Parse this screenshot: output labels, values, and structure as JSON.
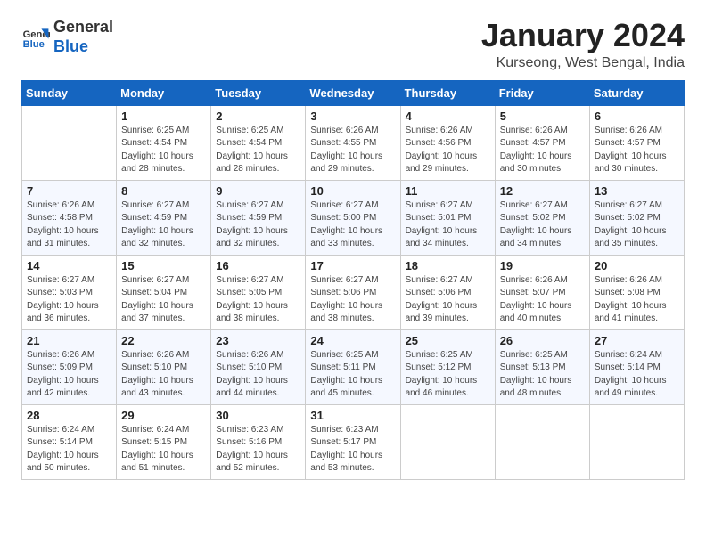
{
  "header": {
    "logo_line1": "General",
    "logo_line2": "Blue",
    "title": "January 2024",
    "subtitle": "Kurseong, West Bengal, India"
  },
  "columns": [
    "Sunday",
    "Monday",
    "Tuesday",
    "Wednesday",
    "Thursday",
    "Friday",
    "Saturday"
  ],
  "weeks": [
    [
      {
        "day": "",
        "info": ""
      },
      {
        "day": "1",
        "info": "Sunrise: 6:25 AM\nSunset: 4:54 PM\nDaylight: 10 hours\nand 28 minutes."
      },
      {
        "day": "2",
        "info": "Sunrise: 6:25 AM\nSunset: 4:54 PM\nDaylight: 10 hours\nand 28 minutes."
      },
      {
        "day": "3",
        "info": "Sunrise: 6:26 AM\nSunset: 4:55 PM\nDaylight: 10 hours\nand 29 minutes."
      },
      {
        "day": "4",
        "info": "Sunrise: 6:26 AM\nSunset: 4:56 PM\nDaylight: 10 hours\nand 29 minutes."
      },
      {
        "day": "5",
        "info": "Sunrise: 6:26 AM\nSunset: 4:57 PM\nDaylight: 10 hours\nand 30 minutes."
      },
      {
        "day": "6",
        "info": "Sunrise: 6:26 AM\nSunset: 4:57 PM\nDaylight: 10 hours\nand 30 minutes."
      }
    ],
    [
      {
        "day": "7",
        "info": "Sunrise: 6:26 AM\nSunset: 4:58 PM\nDaylight: 10 hours\nand 31 minutes."
      },
      {
        "day": "8",
        "info": "Sunrise: 6:27 AM\nSunset: 4:59 PM\nDaylight: 10 hours\nand 32 minutes."
      },
      {
        "day": "9",
        "info": "Sunrise: 6:27 AM\nSunset: 4:59 PM\nDaylight: 10 hours\nand 32 minutes."
      },
      {
        "day": "10",
        "info": "Sunrise: 6:27 AM\nSunset: 5:00 PM\nDaylight: 10 hours\nand 33 minutes."
      },
      {
        "day": "11",
        "info": "Sunrise: 6:27 AM\nSunset: 5:01 PM\nDaylight: 10 hours\nand 34 minutes."
      },
      {
        "day": "12",
        "info": "Sunrise: 6:27 AM\nSunset: 5:02 PM\nDaylight: 10 hours\nand 34 minutes."
      },
      {
        "day": "13",
        "info": "Sunrise: 6:27 AM\nSunset: 5:02 PM\nDaylight: 10 hours\nand 35 minutes."
      }
    ],
    [
      {
        "day": "14",
        "info": "Sunrise: 6:27 AM\nSunset: 5:03 PM\nDaylight: 10 hours\nand 36 minutes."
      },
      {
        "day": "15",
        "info": "Sunrise: 6:27 AM\nSunset: 5:04 PM\nDaylight: 10 hours\nand 37 minutes."
      },
      {
        "day": "16",
        "info": "Sunrise: 6:27 AM\nSunset: 5:05 PM\nDaylight: 10 hours\nand 38 minutes."
      },
      {
        "day": "17",
        "info": "Sunrise: 6:27 AM\nSunset: 5:06 PM\nDaylight: 10 hours\nand 38 minutes."
      },
      {
        "day": "18",
        "info": "Sunrise: 6:27 AM\nSunset: 5:06 PM\nDaylight: 10 hours\nand 39 minutes."
      },
      {
        "day": "19",
        "info": "Sunrise: 6:26 AM\nSunset: 5:07 PM\nDaylight: 10 hours\nand 40 minutes."
      },
      {
        "day": "20",
        "info": "Sunrise: 6:26 AM\nSunset: 5:08 PM\nDaylight: 10 hours\nand 41 minutes."
      }
    ],
    [
      {
        "day": "21",
        "info": "Sunrise: 6:26 AM\nSunset: 5:09 PM\nDaylight: 10 hours\nand 42 minutes."
      },
      {
        "day": "22",
        "info": "Sunrise: 6:26 AM\nSunset: 5:10 PM\nDaylight: 10 hours\nand 43 minutes."
      },
      {
        "day": "23",
        "info": "Sunrise: 6:26 AM\nSunset: 5:10 PM\nDaylight: 10 hours\nand 44 minutes."
      },
      {
        "day": "24",
        "info": "Sunrise: 6:25 AM\nSunset: 5:11 PM\nDaylight: 10 hours\nand 45 minutes."
      },
      {
        "day": "25",
        "info": "Sunrise: 6:25 AM\nSunset: 5:12 PM\nDaylight: 10 hours\nand 46 minutes."
      },
      {
        "day": "26",
        "info": "Sunrise: 6:25 AM\nSunset: 5:13 PM\nDaylight: 10 hours\nand 48 minutes."
      },
      {
        "day": "27",
        "info": "Sunrise: 6:24 AM\nSunset: 5:14 PM\nDaylight: 10 hours\nand 49 minutes."
      }
    ],
    [
      {
        "day": "28",
        "info": "Sunrise: 6:24 AM\nSunset: 5:14 PM\nDaylight: 10 hours\nand 50 minutes."
      },
      {
        "day": "29",
        "info": "Sunrise: 6:24 AM\nSunset: 5:15 PM\nDaylight: 10 hours\nand 51 minutes."
      },
      {
        "day": "30",
        "info": "Sunrise: 6:23 AM\nSunset: 5:16 PM\nDaylight: 10 hours\nand 52 minutes."
      },
      {
        "day": "31",
        "info": "Sunrise: 6:23 AM\nSunset: 5:17 PM\nDaylight: 10 hours\nand 53 minutes."
      },
      {
        "day": "",
        "info": ""
      },
      {
        "day": "",
        "info": ""
      },
      {
        "day": "",
        "info": ""
      }
    ]
  ]
}
